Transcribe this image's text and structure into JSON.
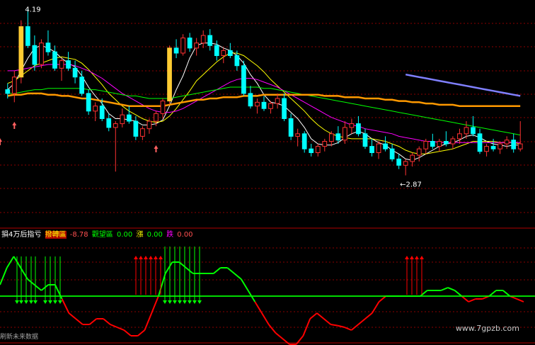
{
  "indicator": {
    "name": "損4万后指亏",
    "buy_label": "撥轉區",
    "buy_value": "-8.78",
    "watch_label": "觀望區",
    "watch_value": "0.00",
    "rise_label": "漲",
    "rise_value": "0.00",
    "fall_label": "跌",
    "fall_value": "0.00"
  },
  "footer_text": "刷新未来数据",
  "watermark": "www.7gpzb.com",
  "colors": {
    "up": "#ff3232",
    "down": "#00ffff",
    "ma5": "#ffffff",
    "ma10": "#ffff00",
    "ma20": "#ff00ff",
    "ma60": "#00ff00",
    "ma120": "#ff9900",
    "ma250": "#8080ff",
    "grid": "#8b0000",
    "ind_up": "#00ff00",
    "ind_down": "#ff0000"
  },
  "chart_data": [
    {
      "type": "candlestick",
      "high_label": "4.19",
      "low_label": "←2.87",
      "ylim": [
        2.8,
        4.25
      ],
      "candles": [
        [
          3.55,
          3.6,
          3.48,
          3.52
        ],
        [
          3.52,
          3.7,
          3.45,
          3.65
        ],
        [
          3.65,
          4.1,
          3.6,
          4.05
        ],
        [
          4.05,
          4.19,
          3.88,
          3.9
        ],
        [
          3.9,
          3.98,
          3.7,
          3.75
        ],
        [
          3.75,
          3.95,
          3.72,
          3.92
        ],
        [
          3.92,
          4.02,
          3.82,
          3.85
        ],
        [
          3.85,
          3.9,
          3.7,
          3.72
        ],
        [
          3.72,
          3.8,
          3.62,
          3.78
        ],
        [
          3.78,
          3.85,
          3.7,
          3.72
        ],
        [
          3.72,
          3.78,
          3.6,
          3.65
        ],
        [
          3.65,
          3.7,
          3.5,
          3.52
        ],
        [
          3.52,
          3.55,
          3.35,
          3.38
        ],
        [
          3.38,
          3.45,
          3.3,
          3.42
        ],
        [
          3.42,
          3.48,
          3.3,
          3.32
        ],
        [
          3.32,
          3.36,
          3.22,
          3.25
        ],
        [
          3.25,
          3.3,
          2.9,
          3.28
        ],
        [
          3.28,
          3.4,
          3.25,
          3.35
        ],
        [
          3.35,
          3.42,
          3.28,
          3.3
        ],
        [
          3.3,
          3.34,
          3.15,
          3.18
        ],
        [
          3.18,
          3.26,
          3.15,
          3.24
        ],
        [
          3.24,
          3.32,
          3.2,
          3.3
        ],
        [
          3.3,
          3.38,
          3.26,
          3.36
        ],
        [
          3.36,
          3.48,
          3.32,
          3.46
        ],
        [
          3.46,
          3.9,
          3.44,
          3.88
        ],
        [
          3.88,
          3.95,
          3.8,
          3.84
        ],
        [
          3.84,
          3.99,
          3.82,
          3.96
        ],
        [
          3.96,
          4.0,
          3.85,
          3.88
        ],
        [
          3.88,
          3.96,
          3.82,
          3.92
        ],
        [
          3.92,
          4.02,
          3.88,
          3.98
        ],
        [
          3.98,
          4.03,
          3.86,
          3.9
        ],
        [
          3.9,
          3.94,
          3.78,
          3.82
        ],
        [
          3.82,
          3.88,
          3.76,
          3.86
        ],
        [
          3.86,
          3.92,
          3.8,
          3.82
        ],
        [
          3.82,
          3.86,
          3.7,
          3.74
        ],
        [
          3.74,
          3.78,
          3.5,
          3.52
        ],
        [
          3.52,
          3.58,
          3.4,
          3.42
        ],
        [
          3.42,
          3.48,
          3.36,
          3.45
        ],
        [
          3.45,
          3.5,
          3.38,
          3.4
        ],
        [
          3.4,
          3.46,
          3.36,
          3.44
        ],
        [
          3.44,
          3.52,
          3.4,
          3.48
        ],
        [
          3.48,
          3.52,
          3.3,
          3.32
        ],
        [
          3.32,
          3.36,
          3.15,
          3.18
        ],
        [
          3.18,
          3.24,
          3.1,
          3.2
        ],
        [
          3.2,
          3.22,
          3.05,
          3.08
        ],
        [
          3.08,
          3.12,
          3.02,
          3.05
        ],
        [
          3.05,
          3.12,
          3.02,
          3.1
        ],
        [
          3.1,
          3.16,
          3.06,
          3.14
        ],
        [
          3.14,
          3.22,
          3.1,
          3.2
        ],
        [
          3.2,
          3.26,
          3.12,
          3.15
        ],
        [
          3.15,
          3.3,
          3.12,
          3.25
        ],
        [
          3.25,
          3.32,
          3.2,
          3.28
        ],
        [
          3.28,
          3.34,
          3.18,
          3.2
        ],
        [
          3.2,
          3.24,
          3.08,
          3.1
        ],
        [
          3.1,
          3.16,
          3.02,
          3.05
        ],
        [
          3.05,
          3.14,
          3.0,
          3.12
        ],
        [
          3.12,
          3.18,
          3.06,
          3.08
        ],
        [
          3.08,
          3.12,
          2.98,
          3.0
        ],
        [
          3.0,
          3.04,
          2.92,
          2.95
        ],
        [
          2.95,
          3.0,
          2.87,
          2.98
        ],
        [
          2.98,
          3.05,
          2.94,
          3.03
        ],
        [
          3.03,
          3.1,
          2.98,
          3.08
        ],
        [
          3.08,
          3.16,
          3.04,
          3.14
        ],
        [
          3.14,
          3.2,
          3.08,
          3.1
        ],
        [
          3.1,
          3.16,
          3.06,
          3.14
        ],
        [
          3.14,
          3.22,
          3.1,
          3.12
        ],
        [
          3.12,
          3.18,
          3.08,
          3.16
        ],
        [
          3.16,
          3.24,
          3.12,
          3.2
        ],
        [
          3.2,
          3.3,
          3.16,
          3.25
        ],
        [
          3.25,
          3.34,
          3.18,
          3.2
        ],
        [
          3.2,
          3.24,
          3.04,
          3.06
        ],
        [
          3.06,
          3.12,
          3.02,
          3.1
        ],
        [
          3.1,
          3.16,
          3.06,
          3.08
        ],
        [
          3.08,
          3.14,
          3.04,
          3.12
        ],
        [
          3.12,
          3.18,
          3.08,
          3.15
        ],
        [
          3.15,
          3.2,
          3.05,
          3.08
        ],
        [
          3.08,
          3.3,
          3.06,
          3.12
        ]
      ],
      "overlays": [
        {
          "name": "MA5",
          "color": "#ffffff",
          "values": [
            3.55,
            3.6,
            3.7,
            3.8,
            3.88,
            3.9,
            3.88,
            3.85,
            3.8,
            3.76,
            3.73,
            3.66,
            3.57,
            3.5,
            3.44,
            3.36,
            3.32,
            3.32,
            3.31,
            3.3,
            3.27,
            3.27,
            3.28,
            3.31,
            3.42,
            3.55,
            3.66,
            3.8,
            3.9,
            3.92,
            3.92,
            3.91,
            3.88,
            3.86,
            3.82,
            3.76,
            3.67,
            3.6,
            3.51,
            3.45,
            3.44,
            3.42,
            3.37,
            3.32,
            3.25,
            3.16,
            3.12,
            3.11,
            3.11,
            3.13,
            3.17,
            3.2,
            3.22,
            3.2,
            3.16,
            3.13,
            3.11,
            3.07,
            3.04,
            3.0,
            2.99,
            3.01,
            3.04,
            3.07,
            3.1,
            3.12,
            3.13,
            3.15,
            3.18,
            3.19,
            3.17,
            3.14,
            3.12,
            3.11,
            3.1,
            3.11,
            3.11
          ]
        },
        {
          "name": "MA10",
          "color": "#ffff00",
          "values": [
            3.6,
            3.62,
            3.66,
            3.7,
            3.74,
            3.76,
            3.78,
            3.8,
            3.81,
            3.8,
            3.79,
            3.76,
            3.71,
            3.65,
            3.59,
            3.52,
            3.47,
            3.42,
            3.38,
            3.35,
            3.32,
            3.3,
            3.29,
            3.3,
            3.34,
            3.4,
            3.47,
            3.54,
            3.62,
            3.67,
            3.72,
            3.77,
            3.81,
            3.84,
            3.84,
            3.82,
            3.78,
            3.74,
            3.69,
            3.63,
            3.58,
            3.53,
            3.48,
            3.43,
            3.38,
            3.32,
            3.27,
            3.23,
            3.2,
            3.18,
            3.17,
            3.16,
            3.16,
            3.16,
            3.16,
            3.15,
            3.14,
            3.12,
            3.1,
            3.07,
            3.05,
            3.04,
            3.04,
            3.05,
            3.06,
            3.07,
            3.08,
            3.1,
            3.12,
            3.14,
            3.14,
            3.14,
            3.14,
            3.13,
            3.13,
            3.13,
            3.12
          ]
        },
        {
          "name": "MA20",
          "color": "#ff00ff",
          "values": [
            3.7,
            3.7,
            3.71,
            3.72,
            3.73,
            3.74,
            3.75,
            3.75,
            3.75,
            3.75,
            3.74,
            3.72,
            3.7,
            3.67,
            3.64,
            3.6,
            3.56,
            3.52,
            3.49,
            3.46,
            3.43,
            3.4,
            3.38,
            3.37,
            3.37,
            3.38,
            3.4,
            3.43,
            3.46,
            3.49,
            3.52,
            3.55,
            3.58,
            3.61,
            3.63,
            3.64,
            3.64,
            3.63,
            3.61,
            3.59,
            3.57,
            3.54,
            3.51,
            3.48,
            3.45,
            3.42,
            3.39,
            3.36,
            3.33,
            3.31,
            3.29,
            3.27,
            3.26,
            3.24,
            3.23,
            3.22,
            3.21,
            3.2,
            3.18,
            3.17,
            3.16,
            3.15,
            3.14,
            3.14,
            3.13,
            3.13,
            3.13,
            3.13,
            3.13,
            3.13,
            3.13,
            3.13,
            3.13,
            3.13,
            3.13,
            3.13,
            3.13
          ]
        },
        {
          "name": "MA60",
          "color": "#00ff00",
          "values": [
            3.52,
            3.52,
            3.53,
            3.54,
            3.55,
            3.55,
            3.56,
            3.56,
            3.56,
            3.56,
            3.56,
            3.56,
            3.55,
            3.55,
            3.54,
            3.53,
            3.52,
            3.51,
            3.5,
            3.5,
            3.49,
            3.48,
            3.48,
            3.48,
            3.48,
            3.49,
            3.5,
            3.51,
            3.52,
            3.53,
            3.54,
            3.55,
            3.56,
            3.57,
            3.57,
            3.57,
            3.57,
            3.57,
            3.56,
            3.56,
            3.55,
            3.54,
            3.53,
            3.52,
            3.51,
            3.5,
            3.49,
            3.48,
            3.47,
            3.46,
            3.45,
            3.44,
            3.43,
            3.42,
            3.41,
            3.4,
            3.39,
            3.38,
            3.37,
            3.36,
            3.35,
            3.34,
            3.33,
            3.32,
            3.31,
            3.3,
            3.29,
            3.28,
            3.27,
            3.26,
            3.25,
            3.24,
            3.23,
            3.22,
            3.21,
            3.2,
            3.19
          ]
        },
        {
          "name": "MA120",
          "color": "#ff9900",
          "values": [
            3.5,
            3.51,
            3.51,
            3.52,
            3.52,
            3.52,
            3.51,
            3.51,
            3.5,
            3.5,
            3.49,
            3.48,
            3.48,
            3.47,
            3.46,
            3.45,
            3.44,
            3.43,
            3.42,
            3.42,
            3.42,
            3.42,
            3.42,
            3.42,
            3.43,
            3.44,
            3.45,
            3.46,
            3.47,
            3.47,
            3.48,
            3.48,
            3.49,
            3.49,
            3.49,
            3.5,
            3.5,
            3.5,
            3.51,
            3.51,
            3.51,
            3.51,
            3.51,
            3.51,
            3.51,
            3.51,
            3.51,
            3.5,
            3.5,
            3.5,
            3.49,
            3.49,
            3.49,
            3.48,
            3.48,
            3.48,
            3.47,
            3.47,
            3.46,
            3.46,
            3.45,
            3.45,
            3.44,
            3.44,
            3.43,
            3.43,
            3.43,
            3.42,
            3.42,
            3.42,
            3.42,
            3.42,
            3.42,
            3.42,
            3.42,
            3.42,
            3.42
          ]
        },
        {
          "name": "MA250",
          "color": "#8080ff",
          "values": [
            null,
            null,
            null,
            null,
            null,
            null,
            null,
            null,
            null,
            null,
            null,
            null,
            null,
            null,
            null,
            null,
            null,
            null,
            null,
            null,
            null,
            null,
            null,
            null,
            null,
            null,
            null,
            null,
            null,
            null,
            null,
            null,
            null,
            null,
            null,
            null,
            null,
            null,
            null,
            null,
            null,
            null,
            null,
            null,
            null,
            null,
            null,
            null,
            null,
            null,
            null,
            null,
            null,
            null,
            null,
            null,
            null,
            null,
            null,
            3.67,
            3.66,
            3.65,
            3.64,
            3.63,
            3.62,
            3.61,
            3.6,
            3.59,
            3.58,
            3.57,
            3.56,
            3.55,
            3.54,
            3.53,
            3.52,
            3.51,
            3.5
          ]
        }
      ],
      "up_arrows": [
        1,
        22
      ]
    },
    {
      "type": "oscillator",
      "ylim": [
        -10,
        10
      ],
      "zero": 0,
      "values": [
        2,
        5,
        7,
        5,
        3,
        2,
        1,
        2,
        2,
        -0.5,
        -3,
        -4,
        -5,
        -5,
        -4,
        -4,
        -5,
        -5.5,
        -6,
        -7,
        -7,
        -6,
        -3,
        0,
        4,
        6,
        6,
        5,
        4,
        4,
        4,
        4,
        5,
        5,
        4,
        3,
        1,
        -1,
        -3,
        -5,
        -6.5,
        -7.5,
        -8.5,
        -8.5,
        -7,
        -4,
        -3,
        -4,
        -5,
        -5.2,
        -5.5,
        -6,
        -5,
        -4,
        -3,
        -1,
        0,
        0,
        0,
        0,
        0,
        0,
        1,
        1,
        1,
        1.5,
        1,
        0,
        -1,
        -0.5,
        -0.5,
        0,
        1,
        1,
        0,
        -0.5,
        -1
      ],
      "sell_arrows": [
        2,
        3,
        4,
        5,
        6,
        8,
        9
      ],
      "buy_arrows_groups": [
        [
          19,
          20,
          21,
          22,
          23
        ],
        [
          59,
          60,
          61,
          62
        ]
      ],
      "sell_arrows_2": [
        23,
        24,
        25,
        26,
        27,
        28,
        29,
        30
      ]
    }
  ]
}
